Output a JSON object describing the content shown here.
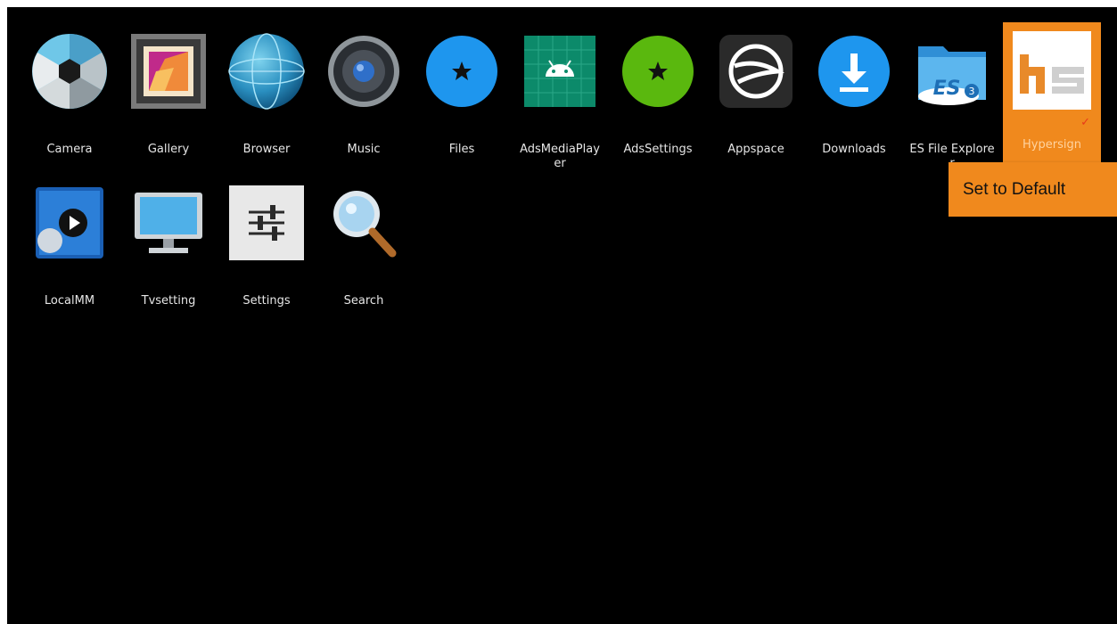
{
  "row1": [
    {
      "label": "Camera",
      "icon": "camera-icon"
    },
    {
      "label": "Gallery",
      "icon": "gallery-icon"
    },
    {
      "label": "Browser",
      "icon": "globe-icon"
    },
    {
      "label": "Music",
      "icon": "speaker-icon"
    },
    {
      "label": "Files",
      "icon": "star-icon"
    },
    {
      "label": "AdsMediaPlayer",
      "icon": "android-icon"
    },
    {
      "label": "AdsSettings",
      "icon": "star-icon"
    },
    {
      "label": "Appspace",
      "icon": "appspace-icon"
    },
    {
      "label": "Downloads",
      "icon": "download-icon"
    },
    {
      "label": "ES File Explorer",
      "icon": "es-folder-icon"
    },
    {
      "label": "Hypersign",
      "icon": "hypersign-logo-icon",
      "selected": true
    }
  ],
  "row2": [
    {
      "label": "LocalMM",
      "icon": "video-play-icon"
    },
    {
      "label": "Tvsetting",
      "icon": "monitor-icon"
    },
    {
      "label": "Settings",
      "icon": "sliders-icon"
    },
    {
      "label": "Search",
      "icon": "magnifier-icon"
    }
  ],
  "context_menu": {
    "item": "Set to Default"
  },
  "colors": {
    "background": "#000000",
    "accent": "#f0891d",
    "label": "#e6e6e6"
  }
}
